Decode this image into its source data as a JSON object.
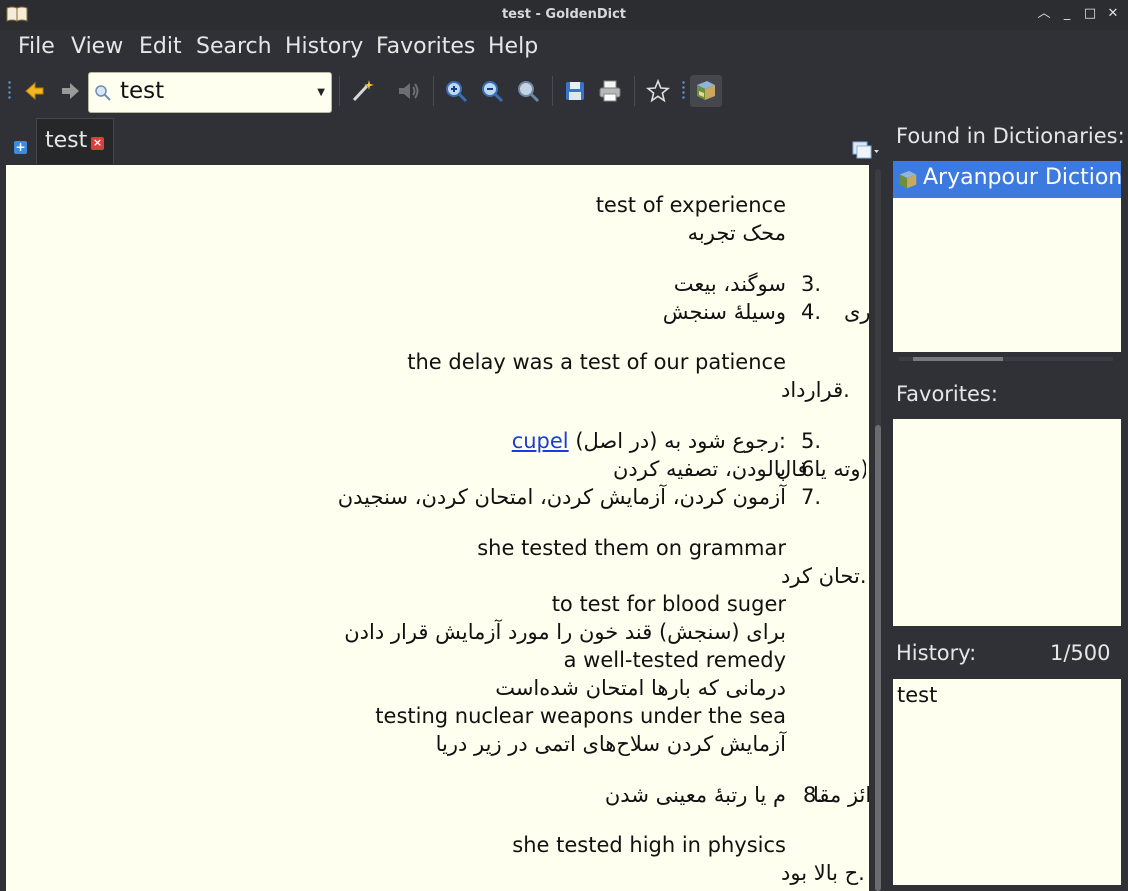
{
  "window": {
    "title": "test - GoldenDict"
  },
  "menu": {
    "file": "File",
    "view": "View",
    "edit": "Edit",
    "search": "Search",
    "history": "History",
    "favorites": "Favorites",
    "help": "Help"
  },
  "search": {
    "value": "test"
  },
  "tab": {
    "label": "test"
  },
  "article": {
    "l0": "test of experience",
    "l1": "محک تجربه",
    "l2": "سوگند، بیعت",
    "l2n": "3.",
    "l3": "وسیلۀ سنجش",
    "l3n": "4.",
    "l3b": "ری)",
    "l4": "the delay was a test of our patience",
    "l5": "قرارداد.",
    "l6a": "(در اصل) رجوع شود به:",
    "l6link": "cupel",
    "l6n": "5.",
    "l7": "پالودن، تصفیه کردن",
    "l7b": "وته یا فال)",
    "l7n": "6.",
    "l8": "آزمون کردن، آزمایش کردن، امتحان کردن، سنجیدن",
    "l8n": "7.",
    "l9": "she tested them on grammar",
    "l10": "تحان کرد.",
    "l11": "to test for blood suger",
    "l12": "برای (سنجش) قند خون را مورد آزمایش قرار دادن",
    "l13": "a well-tested remedy",
    "l14": "درمانی که بارها امتحان شده‌است",
    "l15": "testing nuclear weapons under the sea",
    "l16": "آزمایش کردن سلاح‌های اتمی در زیر دریا",
    "l17": "م یا رتبۀ معینی شدن",
    "l17b": "ائز مقا",
    "l17n": "8.",
    "l18": "she tested high in physics",
    "l19": "ح بالا بود."
  },
  "panels": {
    "found_header": "Found in Dictionaries:",
    "found_item": "Aryanpour Dictionary",
    "favorites_header": "Favorites:",
    "history_header": "History:",
    "history_count": "1/500",
    "history_item": "test"
  },
  "colors": {
    "accent": "#3d7ae0",
    "article_bg": "#fffff0",
    "chrome": "#2f3136",
    "link": "#1a3dd6"
  },
  "icons": [
    "back-arrow-icon",
    "forward-arrow-icon",
    "magic-wand-icon",
    "speaker-icon",
    "zoom-in-icon",
    "zoom-out-icon",
    "zoom-reset-icon",
    "save-icon",
    "print-icon",
    "star-icon",
    "dictionary-book-icon"
  ]
}
